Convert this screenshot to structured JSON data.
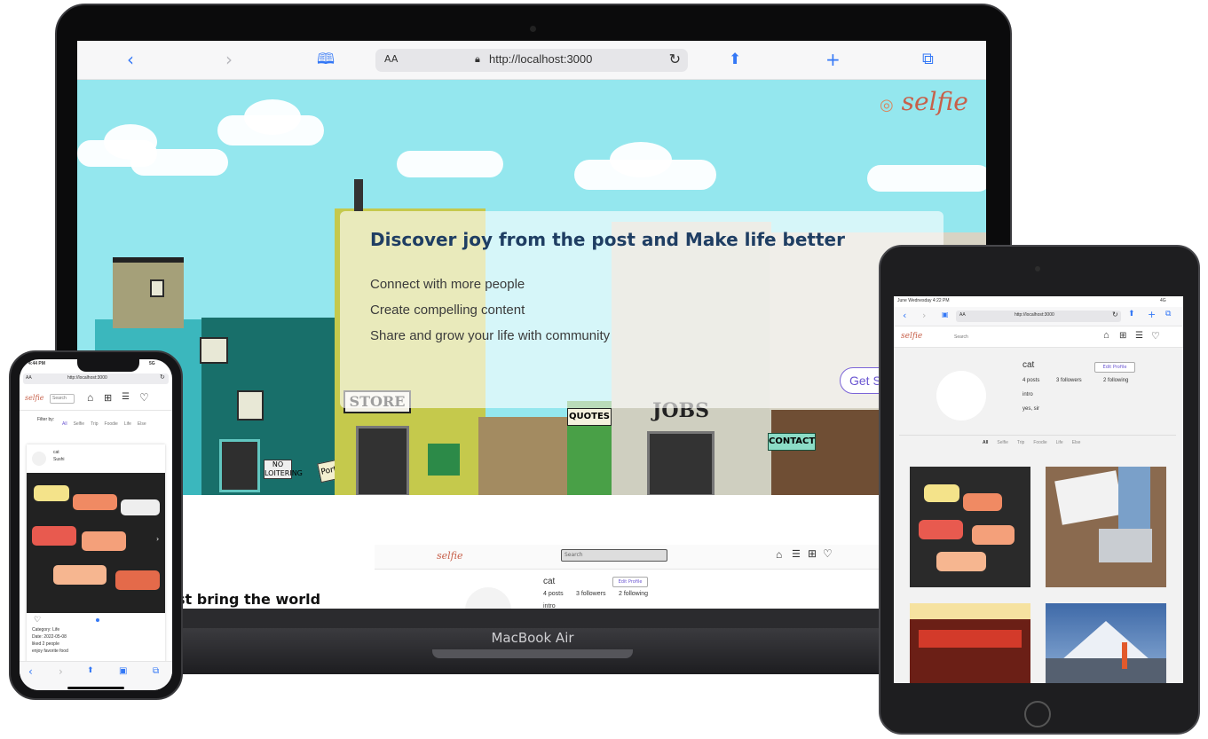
{
  "macbook": {
    "label": "MacBook Air",
    "safari": {
      "aa": "AA",
      "url": "http://localhost:3000",
      "icons": [
        "back-icon",
        "forward-icon",
        "bookmarks-icon",
        "share-icon",
        "new-tab-icon",
        "tabs-icon"
      ]
    },
    "hero": {
      "logo": "selfie",
      "title": "Discover joy from the post and Make life better",
      "lines": [
        "Connect with more people",
        "Create compelling content",
        "Share and grow your life with community"
      ],
      "cta": "Get S",
      "signs": {
        "store": "STORE",
        "quotes": "QUOTES",
        "jobs": "JOBS",
        "contact": "CONTACT",
        "no_loitering": "NO LOITERING",
        "portfolio": "Portfolio"
      }
    },
    "lower": {
      "heading": "st bring the world",
      "mini_logo": "selfie",
      "mini_search": "Search",
      "profile_name": "cat",
      "edit_profile": "Edit Profile",
      "posts": "4 posts",
      "followers": "3 followers",
      "following": "2 following",
      "intro": "intro"
    }
  },
  "ipad": {
    "status_left": "June Wednesday 4:22 PM",
    "status_right": "4G",
    "url": "http://localhost:3000",
    "aa": "AA",
    "logo": "selfie",
    "search": "Search",
    "profile_name": "cat",
    "edit_profile": "Edit Profile",
    "posts": "4 posts",
    "followers": "3 followers",
    "following": "2 following",
    "intro": "intro",
    "yes": "yes, sir",
    "filters": [
      "All",
      "Selfie",
      "Trip",
      "Foodie",
      "Life",
      "Else"
    ]
  },
  "iphone": {
    "time": "4:44 PM",
    "signal": "5G",
    "url": "http://localhost:3000",
    "aa": "AA",
    "logo": "selfie",
    "search": "Search",
    "filter_label": "Filter by:",
    "filters": [
      "All",
      "Selfie",
      "Trip",
      "Foodie",
      "Life",
      "Else"
    ],
    "post_user": "cat",
    "post_sub": "Sushi",
    "category": "Category: Life",
    "date": "Date: 2022-05-08",
    "likes": "liked 2 people",
    "caption": "enjoy favorite food"
  }
}
